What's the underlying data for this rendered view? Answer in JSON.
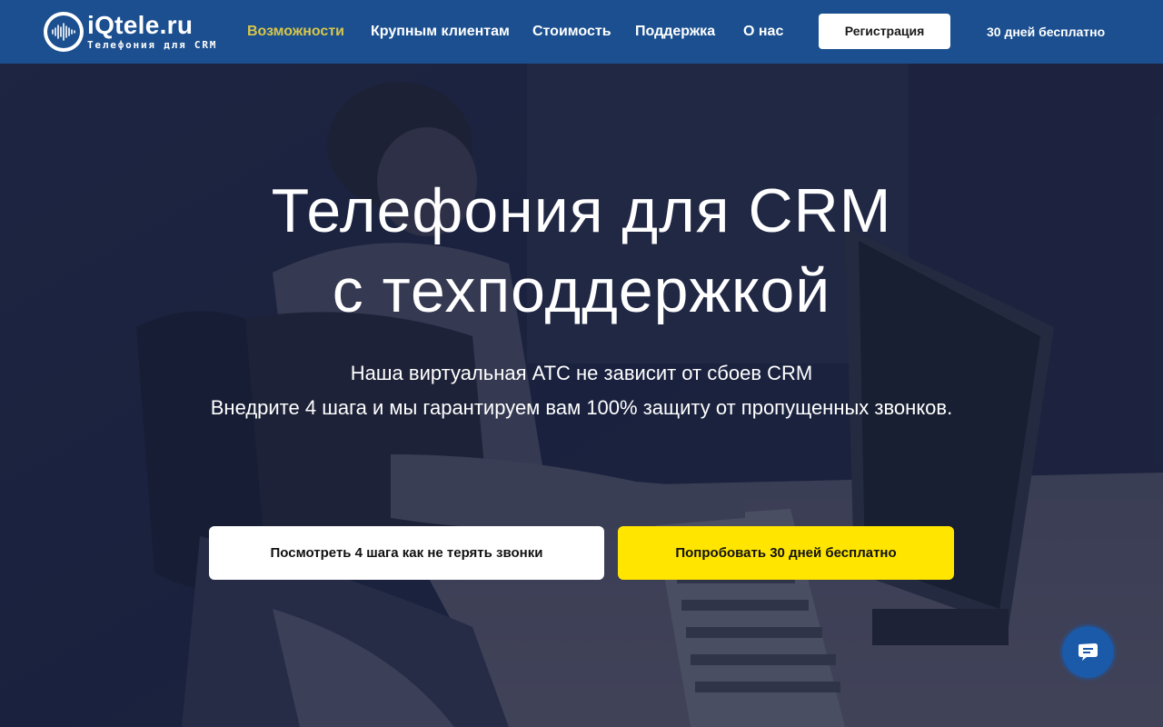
{
  "header": {
    "logo_name": "iQtele.ru",
    "logo_tagline": "Телефония для CRM",
    "nav": [
      {
        "label": "Возможности",
        "active": true
      },
      {
        "label": "Крупным клиентам",
        "active": false
      },
      {
        "label": "Стоимость",
        "active": false
      },
      {
        "label": "Поддержка",
        "active": false
      },
      {
        "label": "О нас",
        "active": false
      }
    ],
    "register_label": "Регистрация",
    "free_trial_link": "30 дней бесплатно"
  },
  "hero": {
    "title_line1": "Телефония для CRM",
    "title_line2": "с техподдержкой",
    "subtitle_line1": "Наша виртуальная АТС не зависит от сбоев CRM",
    "subtitle_line2": "Внедрите 4 шага и мы гарантируем вам 100% защиту от пропущенных звонков.",
    "cta_primary": "Посмотреть 4 шага как не терять звонки",
    "cta_secondary": "Попробовать 30 дней бесплатно"
  },
  "widgets": {
    "chat_icon": "chat-icon"
  },
  "colors": {
    "header_bg": "#1b4f8f",
    "nav_active": "#d8c64a",
    "cta_yellow": "#ffe500",
    "chat_widget_bg": "#1b5aa8"
  }
}
